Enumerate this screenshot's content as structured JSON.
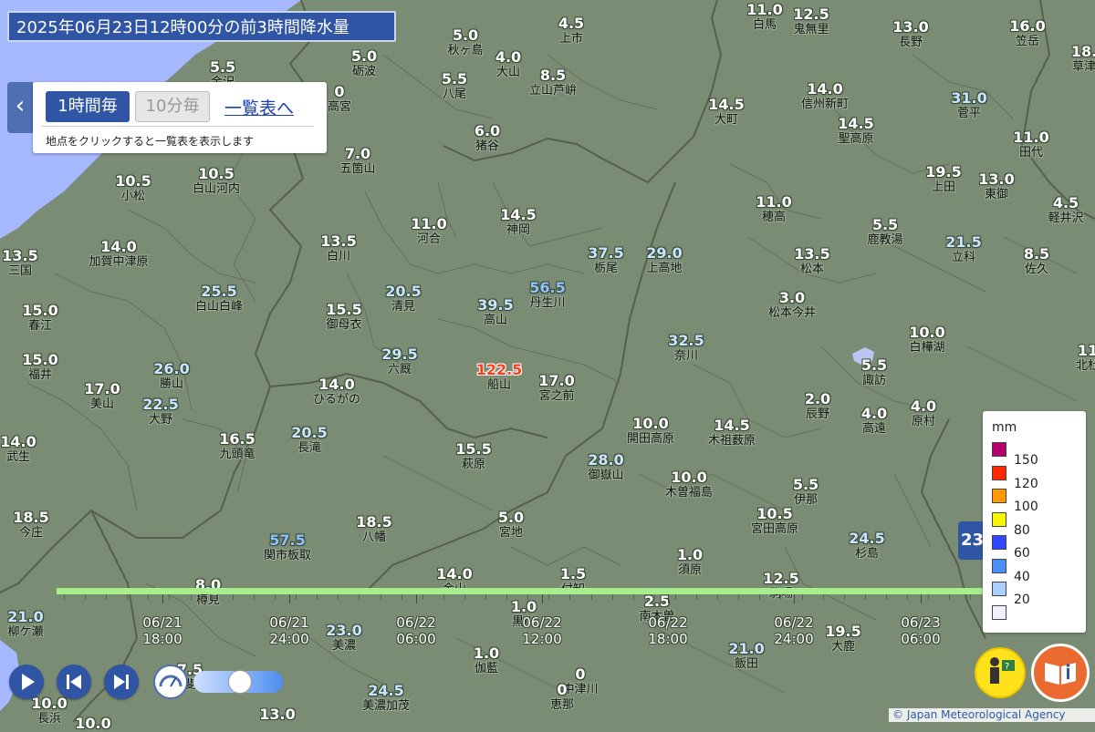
{
  "title": "2025年06月23日12時00分の前3時間降水量",
  "controls": {
    "hourly_label": "1時間毎",
    "ten_min_label": "10分毎",
    "list_link_label": "一覧表へ",
    "note": "地点をクリックすると一覧表を表示します"
  },
  "stations": [
    {
      "name": "秋ヶ島",
      "value": "5.0"
    },
    {
      "name": "上市",
      "value": "4.5"
    },
    {
      "name": "白馬",
      "value": "11.0"
    },
    {
      "name": "鬼無里",
      "value": "12.5"
    },
    {
      "name": "長野",
      "value": "13.0"
    },
    {
      "name": "笠岳",
      "value": "16.0"
    },
    {
      "name": "草津",
      "value": "18."
    },
    {
      "name": "砺波",
      "value": "5.0"
    },
    {
      "name": "大山",
      "value": "4.0"
    },
    {
      "name": "立山芦峅",
      "value": "8.5"
    },
    {
      "name": "八尾",
      "value": "5.5"
    },
    {
      "name": "金沢",
      "value": "5.5"
    },
    {
      "name": "高宮",
      "value": "0"
    },
    {
      "name": "大町",
      "value": "14.5"
    },
    {
      "name": "信州新町",
      "value": "14.0"
    },
    {
      "name": "菅平",
      "value": "31.0"
    },
    {
      "name": "聖高原",
      "value": "14.5"
    },
    {
      "name": "猪谷",
      "value": "6.0"
    },
    {
      "name": "田代",
      "value": "11.0"
    },
    {
      "name": "五箇山",
      "value": "7.0"
    },
    {
      "name": "上田",
      "value": "19.5"
    },
    {
      "name": "東御",
      "value": "13.0"
    },
    {
      "name": "小松",
      "value": "10.5"
    },
    {
      "name": "白山河内",
      "value": "10.5"
    },
    {
      "name": "穂高",
      "value": "11.0"
    },
    {
      "name": "軽井沢",
      "value": "4.5"
    },
    {
      "name": "河合",
      "value": "11.0"
    },
    {
      "name": "神岡",
      "value": "14.5"
    },
    {
      "name": "鹿教湯",
      "value": "5.5"
    },
    {
      "name": "白川",
      "value": "13.5"
    },
    {
      "name": "立科",
      "value": "21.5"
    },
    {
      "name": "三国",
      "value": "13.5"
    },
    {
      "name": "加賀中津原",
      "value": "14.0"
    },
    {
      "name": "栃尾",
      "value": "37.5"
    },
    {
      "name": "上高地",
      "value": "29.0"
    },
    {
      "name": "松本",
      "value": "13.5"
    },
    {
      "name": "佐久",
      "value": "8.5"
    },
    {
      "name": "丹生川",
      "value": "56.5"
    },
    {
      "name": "白山白峰",
      "value": "25.5"
    },
    {
      "name": "清見",
      "value": "20.5"
    },
    {
      "name": "高山",
      "value": "39.5"
    },
    {
      "name": "松本今井",
      "value": "3.0"
    },
    {
      "name": "春江",
      "value": "15.0"
    },
    {
      "name": "御母衣",
      "value": "15.5"
    },
    {
      "name": "白樺湖",
      "value": "10.0"
    },
    {
      "name": "奈川",
      "value": "32.5"
    },
    {
      "name": "福井",
      "value": "15.0"
    },
    {
      "name": "六厩",
      "value": "29.5"
    },
    {
      "name": "勝山",
      "value": "26.0"
    },
    {
      "name": "諏訪",
      "value": "5.5"
    },
    {
      "name": "北杜",
      "value": "11"
    },
    {
      "name": "船山",
      "value": "122.5"
    },
    {
      "name": "宮之前",
      "value": "17.0"
    },
    {
      "name": "美山",
      "value": "17.0"
    },
    {
      "name": "ひるがの",
      "value": "14.0"
    },
    {
      "name": "大野",
      "value": "22.5"
    },
    {
      "name": "辰野",
      "value": "2.0"
    },
    {
      "name": "原村",
      "value": "4.0"
    },
    {
      "name": "高遠",
      "value": "4.0"
    },
    {
      "name": "開田高原",
      "value": "10.0"
    },
    {
      "name": "木祖薮原",
      "value": "14.5"
    },
    {
      "name": "武生",
      "value": "14.0"
    },
    {
      "name": "九頭竜",
      "value": "16.5"
    },
    {
      "name": "長滝",
      "value": "20.5"
    },
    {
      "name": "萩原",
      "value": "15.5"
    },
    {
      "name": "御嶽山",
      "value": "28.0"
    },
    {
      "name": "木曽福島",
      "value": "10.0"
    },
    {
      "name": "伊那",
      "value": "5.5"
    },
    {
      "name": "宮田高原",
      "value": "10.5"
    },
    {
      "name": "今庄",
      "value": "18.5"
    },
    {
      "name": "関市板取",
      "value": "57.5"
    },
    {
      "name": "八幡",
      "value": "18.5"
    },
    {
      "name": "宮地",
      "value": "5.0"
    },
    {
      "name": "杉島",
      "value": "24.5"
    },
    {
      "name": "須原",
      "value": "1.0"
    },
    {
      "name": "樽見",
      "value": "8.0"
    },
    {
      "name": "金山",
      "value": "14.0"
    },
    {
      "name": "付知",
      "value": "1.5"
    },
    {
      "name": "駒場",
      "value": "12.5"
    },
    {
      "name": "柳ケ瀬",
      "value": "21.0"
    },
    {
      "name": "黒川",
      "value": "1.0"
    },
    {
      "name": "南木曽",
      "value": "2.5"
    },
    {
      "name": "美濃",
      "value": "23.0"
    },
    {
      "name": "大鹿",
      "value": "19.5"
    },
    {
      "name": "伽藍",
      "value": "1.0"
    },
    {
      "name": "飯田",
      "value": "21.0"
    },
    {
      "name": "中津川",
      "value": "0"
    },
    {
      "name": "美濃加茂",
      "value": "24.5"
    },
    {
      "name": "恵那",
      "value": "0"
    },
    {
      "name": "長浜",
      "value": "10.0"
    },
    {
      "name": "揖斐川",
      "value": "7.5"
    },
    {
      "name": "",
      "value": "13.0"
    },
    {
      "name": "",
      "value": "10.0"
    }
  ],
  "timeline": {
    "labels": [
      {
        "date": "06/21",
        "time": "18:00"
      },
      {
        "date": "06/21",
        "time": "24:00"
      },
      {
        "date": "06/22",
        "time": "06:00"
      },
      {
        "date": "06/22",
        "time": "12:00"
      },
      {
        "date": "06/22",
        "time": "18:00"
      },
      {
        "date": "06/22",
        "time": "24:00"
      },
      {
        "date": "06/23",
        "time": "06:00"
      }
    ],
    "side_tab": "23"
  },
  "legend": {
    "unit": "mm",
    "items": [
      {
        "label": "150",
        "color": "#b4006e"
      },
      {
        "label": "120",
        "color": "#ff2800"
      },
      {
        "label": "100",
        "color": "#ff9900"
      },
      {
        "label": "80",
        "color": "#faf500"
      },
      {
        "label": "60",
        "color": "#2f48ff"
      },
      {
        "label": "40",
        "color": "#4a8ef8"
      },
      {
        "label": "20",
        "color": "#a8d0ff"
      },
      {
        "label": "",
        "color": "#f2f2ff"
      }
    ]
  },
  "copyright": "© Japan Meteorological Agency",
  "icons": [
    "chevron-left-icon",
    "play-icon",
    "skip-back-icon",
    "skip-forward-icon",
    "speed-gauge-icon",
    "help-person-icon",
    "info-book-icon"
  ]
}
